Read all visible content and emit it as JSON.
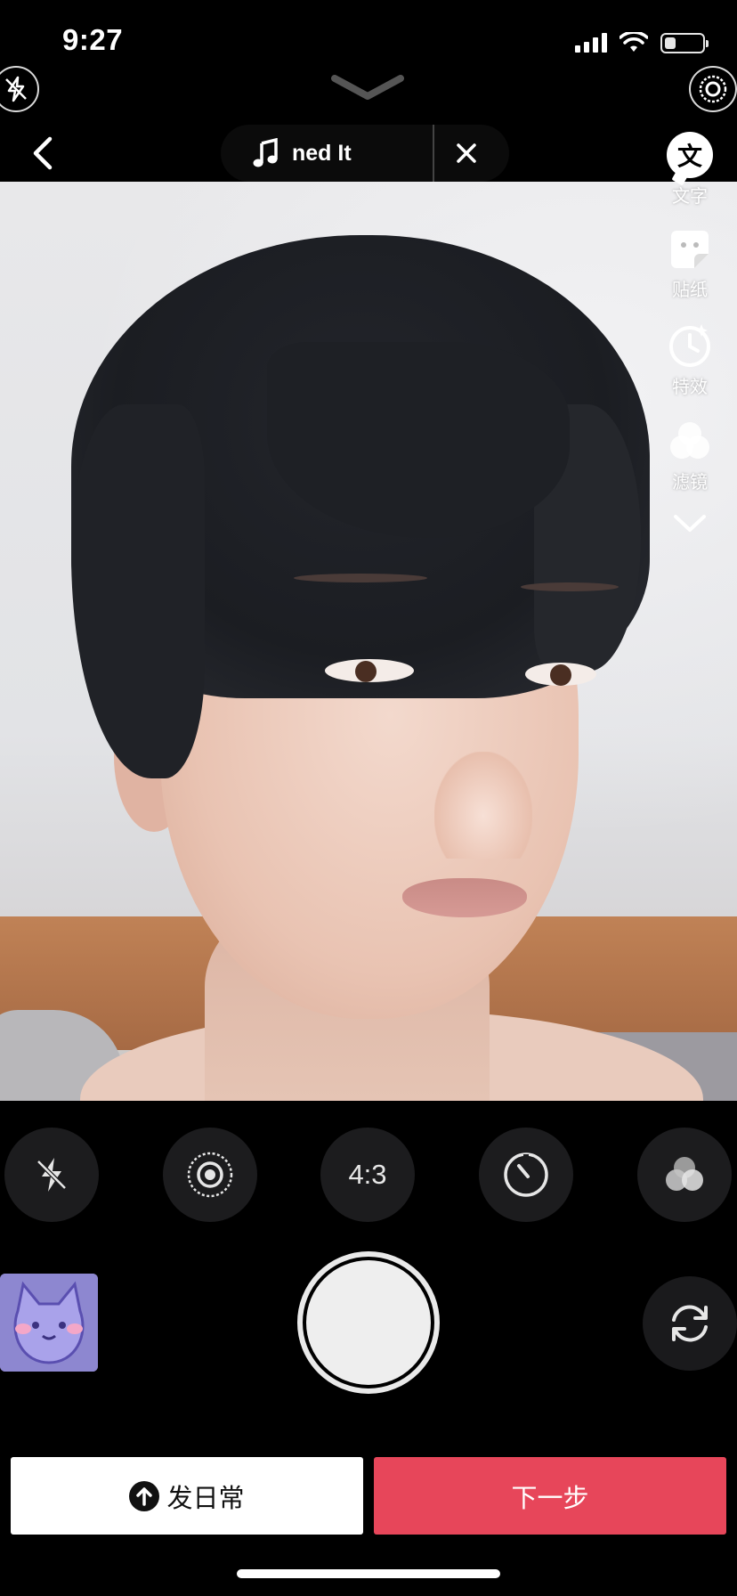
{
  "status_bar": {
    "time": "9:27",
    "battery_level": 0.3
  },
  "topbar": {
    "music_title": "ned It"
  },
  "side_tools": [
    {
      "label": "文字",
      "icon": "text-icon"
    },
    {
      "label": "贴纸",
      "icon": "sticker-icon"
    },
    {
      "label": "特效",
      "icon": "effects-icon"
    },
    {
      "label": "滤镜",
      "icon": "filter-icon"
    }
  ],
  "quick_controls": {
    "aspect_ratio": "4:3"
  },
  "actions": {
    "post_daily": "发日常",
    "next": "下一步"
  },
  "colors": {
    "next_button": "#e7465a",
    "background": "#000000"
  }
}
